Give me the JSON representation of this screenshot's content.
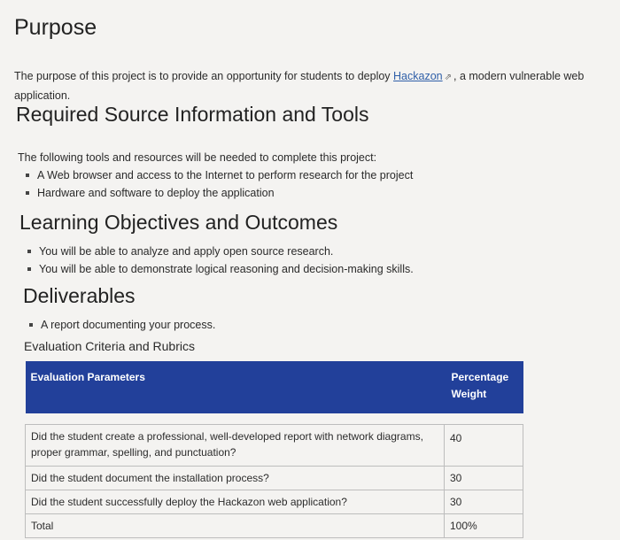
{
  "purpose": {
    "heading": "Purpose",
    "text_before": "The purpose of this project is to provide an opportunity for students to deploy ",
    "link_text": "Hackazon",
    "text_after": ", a modern vulnerable web application."
  },
  "tools": {
    "heading": "Required Source Information and Tools",
    "intro": "The following tools and resources will be needed to complete this project:",
    "items": [
      "A Web browser and access to the Internet to perform research for the project",
      "Hardware and software to deploy the application"
    ]
  },
  "objectives": {
    "heading": "Learning Objectives and Outcomes",
    "items": [
      "You will be able to analyze and apply open source research.",
      "You will be able to demonstrate logical reasoning and decision-making skills."
    ]
  },
  "deliverables": {
    "heading": "Deliverables",
    "items": [
      "A report documenting your process."
    ]
  },
  "evaluation": {
    "title": "Evaluation Criteria and Rubrics",
    "headers": [
      "Evaluation Parameters",
      "Percentage",
      "Weight"
    ],
    "rows": [
      {
        "criterion": "Did the student create a professional, well-developed report with network diagrams, proper grammar, spelling, and punctuation?",
        "weight": "40"
      },
      {
        "criterion": "Did the student document the installation process?",
        "weight": "30"
      },
      {
        "criterion": "Did the student successfully deploy the Hackazon web application?",
        "weight": "30"
      },
      {
        "criterion": "Total",
        "weight": "100%"
      }
    ]
  },
  "colors": {
    "table_header_bg": "#22409a",
    "link": "#2f5fa8",
    "page_bg": "#f4f3f1"
  },
  "icons": {
    "link_icon": "external-link-icon"
  }
}
